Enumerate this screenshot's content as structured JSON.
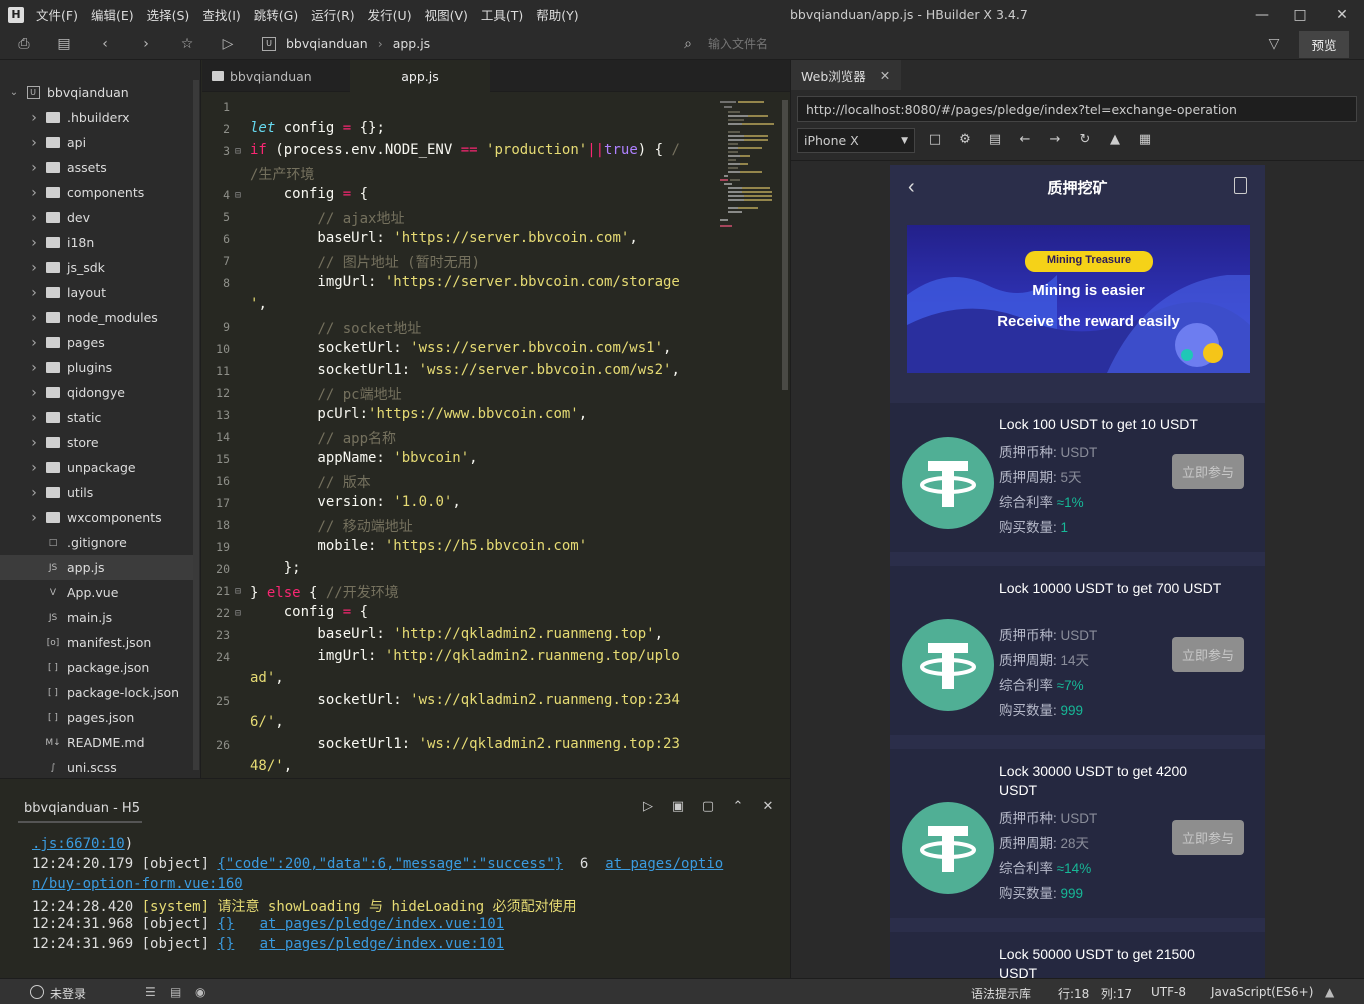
{
  "app": {
    "window_title": "bbvqianduan/app.js - HBuilder X 3.4.7",
    "logo": "H",
    "menu": [
      "文件(F)",
      "编辑(E)",
      "选择(S)",
      "查找(I)",
      "跳转(G)",
      "运行(R)",
      "发行(U)",
      "视图(V)",
      "工具(T)",
      "帮助(Y)"
    ]
  },
  "toolbar": {
    "breadcrumb": [
      "bbvqianduan",
      "app.js"
    ],
    "file_search_placeholder": "输入文件名",
    "preview_label": "预览"
  },
  "sidebar": {
    "items": [
      {
        "label": "bbvqianduan",
        "type": "project",
        "expanded": true
      },
      {
        "label": ".hbuilderx",
        "type": "folder"
      },
      {
        "label": "api",
        "type": "folder"
      },
      {
        "label": "assets",
        "type": "folder"
      },
      {
        "label": "components",
        "type": "folder"
      },
      {
        "label": "dev",
        "type": "folder"
      },
      {
        "label": "i18n",
        "type": "folder"
      },
      {
        "label": "js_sdk",
        "type": "folder"
      },
      {
        "label": "layout",
        "type": "folder"
      },
      {
        "label": "node_modules",
        "type": "folder"
      },
      {
        "label": "pages",
        "type": "folder"
      },
      {
        "label": "plugins",
        "type": "folder"
      },
      {
        "label": "qidongye",
        "type": "folder"
      },
      {
        "label": "static",
        "type": "folder"
      },
      {
        "label": "store",
        "type": "folder"
      },
      {
        "label": "unpackage",
        "type": "folder"
      },
      {
        "label": "utils",
        "type": "folder"
      },
      {
        "label": "wxcomponents",
        "type": "folder"
      },
      {
        "label": ".gitignore",
        "type": "file"
      },
      {
        "label": "app.js",
        "type": "js",
        "selected": true
      },
      {
        "label": "App.vue",
        "type": "vue"
      },
      {
        "label": "main.js",
        "type": "js"
      },
      {
        "label": "manifest.json",
        "type": "manifest"
      },
      {
        "label": "package.json",
        "type": "json"
      },
      {
        "label": "package-lock.json",
        "type": "json"
      },
      {
        "label": "pages.json",
        "type": "json"
      },
      {
        "label": "README.md",
        "type": "md"
      },
      {
        "label": "uni.scss",
        "type": "scss"
      }
    ]
  },
  "editor": {
    "tabs": [
      {
        "label": "bbvqianduan",
        "active": false
      },
      {
        "label": "app.js",
        "active": true
      }
    ],
    "line_numbers": [
      "1",
      "2",
      "3",
      "",
      "4",
      "5",
      "6",
      "7",
      "8",
      "",
      "9",
      "10",
      "11",
      "12",
      "13",
      "14",
      "15",
      "16",
      "17",
      "18",
      "19",
      "20",
      "21",
      "22",
      "23",
      "24",
      "",
      "25",
      "",
      "26",
      ""
    ]
  },
  "console": {
    "title": "bbvqianduan - H5",
    "lines": [
      {
        "link": ".js:6670:10",
        "tail": ")"
      },
      {
        "time": "12:24:20.179",
        "tag": "[object]",
        "link1": "{\"code\":200,\"data\":6,\"message\":\"success\"}",
        "mid": "  6  ",
        "link2": "at pages/optio"
      },
      {
        "link": "n/buy-option-form.vue:160"
      },
      {
        "time": "12:24:28.420",
        "tag": "[system]",
        "msg": "请注意 showLoading 与 hideLoading 必须配对使用"
      },
      {
        "time": "12:24:31.968",
        "tag": "[object]",
        "link1": "{}",
        "link2": "at pages/pledge/index.vue:101"
      },
      {
        "time": "12:24:31.969",
        "tag": "[object]",
        "link1": "{}",
        "link2": "at pages/pledge/index.vue:101"
      }
    ]
  },
  "statusbar": {
    "login": "未登录",
    "syntax_lib": "语法提示库",
    "position": "行:18   列:17",
    "encoding": "UTF-8",
    "language": "JavaScript(ES6+)"
  },
  "browser": {
    "tab_label": "Web浏览器",
    "url": "http://localhost:8080/#/pages/pledge/index?tel=exchange-operation",
    "device": "iPhone X"
  },
  "phone": {
    "title": "质押挖矿",
    "banner": {
      "badge": "Mining Treasure",
      "line1": "Mining is easier",
      "line2": "Receive the reward easily"
    },
    "labels": {
      "coin": "质押币种:",
      "period": "质押周期:",
      "rate": "综合利率",
      "qty": "购买数量:",
      "join": "立即参与"
    },
    "cards": [
      {
        "title": "Lock 100 USDT to get 10 USDT",
        "coin": "USDT",
        "period": "5天",
        "rate": "≈1%",
        "qty": "1"
      },
      {
        "title": "Lock 10000 USDT to get 700 USDT",
        "coin": "USDT",
        "period": "14天",
        "rate": "≈7%",
        "qty": "999"
      },
      {
        "title": "Lock 30000 USDT to get 4200 USDT",
        "coin": "USDT",
        "period": "28天",
        "rate": "≈14%",
        "qty": "999"
      },
      {
        "title": "Lock 50000 USDT to get 21500 USDT"
      }
    ]
  }
}
